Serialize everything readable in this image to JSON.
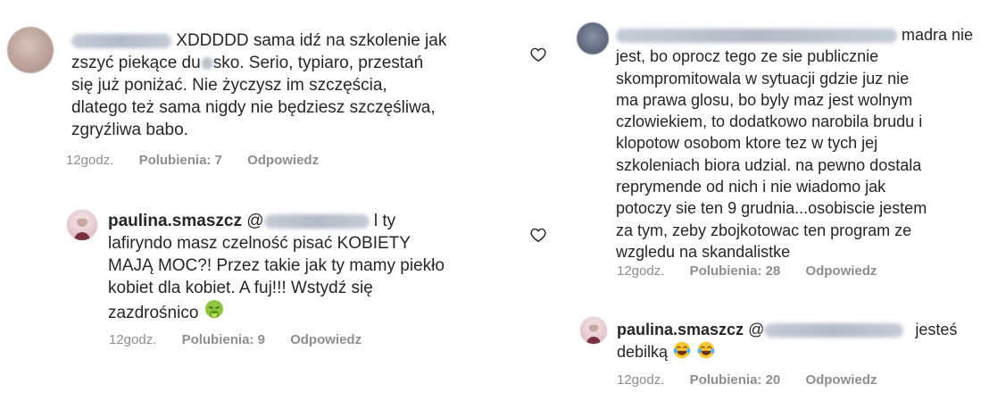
{
  "left": {
    "comment": {
      "lines": [
        "XDDDDD sama idź na szkolenie jak",
        "zszyć piekące du",
        "sko. Serio, typiaro, przestań",
        "się już poniżać. Nie życzysz im szczęścia,",
        "dlatego też sama nigdy nie będziesz szczęśliwa,",
        "zgryźliwa babo."
      ],
      "time": "12godz.",
      "likes": "Polubienia: 7",
      "reply": "Odpowiedz"
    },
    "reply": {
      "username": "paulina.smaszcz",
      "at": "@",
      "lines": [
        "l ty",
        "lafiryndo masz czelność pisać KOBIETY",
        "MAJĄ MOC?! Przez takie jak ty mamy piekło",
        "kobiet dla kobiet. A fuj!!! Wstydź się",
        "zazdrośnico"
      ],
      "time": "12godz.",
      "likes": "Polubienia: 9",
      "reply": "Odpowiedz"
    }
  },
  "right": {
    "comment": {
      "lines": [
        "madra nie",
        "jest, bo oprocz tego ze sie publicznie",
        "skompromitowala w sytuacji gdzie juz nie",
        "ma prawa glosu, bo byly maz jest wolnym",
        "czlowiekiem, to dodatkowo narobila brudu i",
        "klopotow osobom ktore tez w tych jej",
        "szkoleniach biora udzial. na pewno dostala",
        "reprymende od nich i nie wiadomo jak",
        "potoczy sie ten 9 grudnia...osobiscie jestem",
        "za tym, zeby zbojkotowac ten program ze",
        "wzgledu na skandalistke"
      ],
      "time": "12godz.",
      "likes": "Polubienia: 28",
      "reply": "Odpowiedz"
    },
    "reply": {
      "username": "paulina.smaszcz",
      "at": "@",
      "tail": "jesteś",
      "line2": "debilką",
      "time": "12godz.",
      "likes": "Polubienia: 20",
      "reply": "Odpowiedz"
    }
  },
  "icons": {
    "like": "heart-outline-icon",
    "emoji_vomit": "face-vomiting-emoji",
    "emoji_laugh": "face-with-tears-of-joy-emoji"
  },
  "colors": {
    "text": "#262626",
    "meta": "#8e8e8e",
    "background": "#ffffff"
  }
}
